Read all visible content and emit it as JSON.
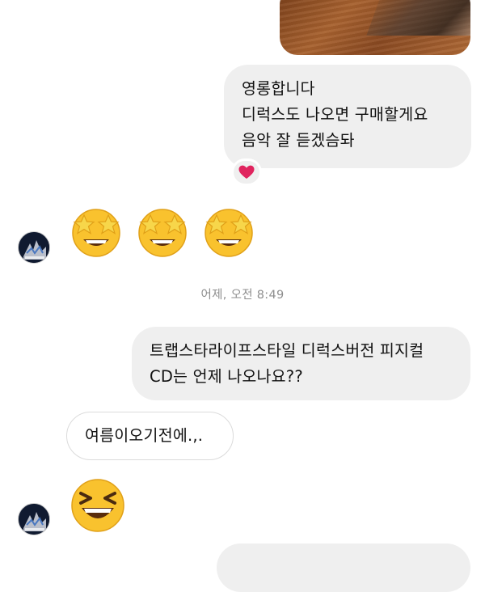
{
  "conversation": {
    "timestamp": "어제, 오전 8:49",
    "messages": {
      "reply_long": "영롱합니다\n디럭스도 나오면 구매할게요\n음악 잘 듣겠슴돠",
      "question": "트랩스타라이프스타일 디럭스버전 피지컬\nCD는 언제 나오나요??",
      "answer": "여름이오기전에.,."
    },
    "reaction_icon": "heart-icon",
    "emoji_groups": {
      "first": [
        "star-struck-emoji",
        "star-struck-emoji",
        "star-struck-emoji"
      ],
      "second": [
        "grinning-squinting-emoji"
      ]
    },
    "colors": {
      "outgoing_bubble": "#efefef",
      "incoming_border": "#dbdbdb",
      "timestamp_text": "#8e8e8e",
      "heart": "#e0245e"
    }
  }
}
